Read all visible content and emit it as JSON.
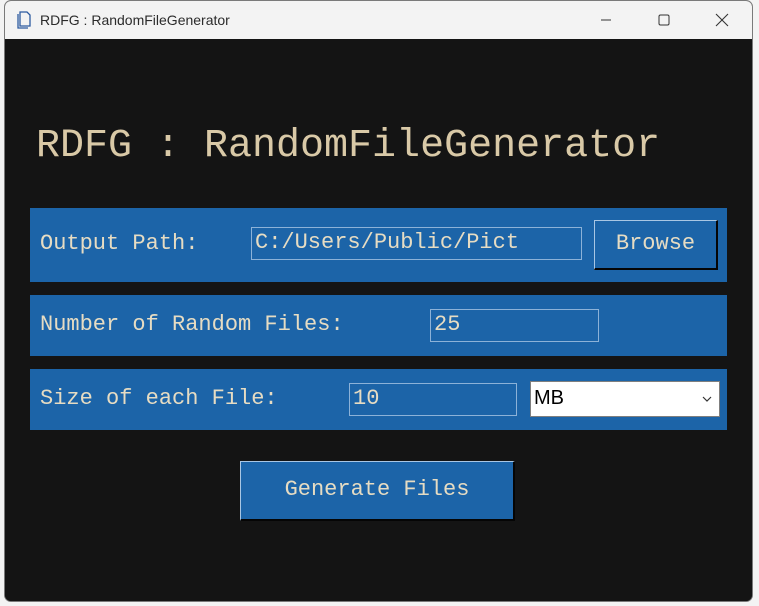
{
  "window": {
    "title": "RDFG : RandomFileGenerator",
    "controls": {
      "minimize_icon": "minimize-icon",
      "maximize_icon": "maximize-icon",
      "close_icon": "close-icon"
    }
  },
  "app": {
    "heading": "RDFG : RandomFileGenerator",
    "output_path": {
      "label": "Output Path:",
      "value": "C:/Users/Public/Pict",
      "browse_label": "Browse"
    },
    "num_files": {
      "label": "Number of Random Files:",
      "value": "25"
    },
    "file_size": {
      "label": "Size of each File:",
      "value": "10",
      "unit_selected": "MB"
    },
    "generate_label": "Generate Files"
  },
  "colors": {
    "background": "#141414",
    "panel": "#1c64a8",
    "text": "#e6dcc3",
    "heading": "#d9c9a7"
  }
}
